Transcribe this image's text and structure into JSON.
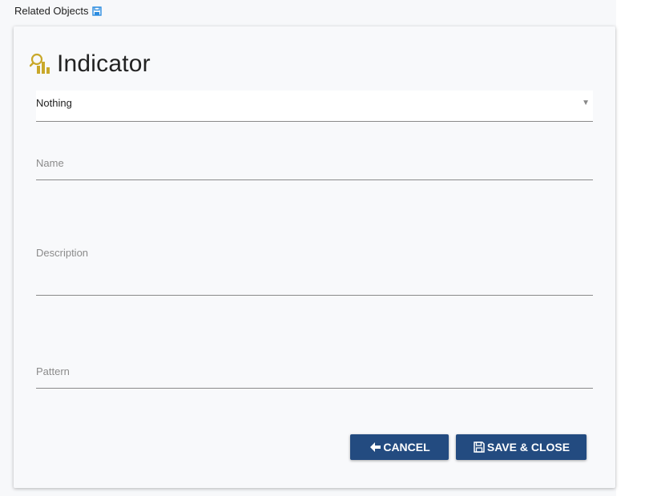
{
  "header": {
    "label": "Related Objects",
    "icon": "save-icon",
    "icon_color": "#2a8ce0"
  },
  "card": {
    "title": "Indicator",
    "title_icon": "indicator-icon",
    "title_icon_color": "#c9a82a",
    "select": {
      "value": "Nothing"
    },
    "fields": {
      "name_label": "Name",
      "description_label": "Description",
      "pattern_label": "Pattern"
    },
    "buttons": {
      "cancel_label": "CANCEL",
      "cancel_icon": "arrow-left-icon",
      "save_close_label": "SAVE & CLOSE",
      "save_close_icon": "save-icon",
      "color": "#234b80"
    }
  }
}
